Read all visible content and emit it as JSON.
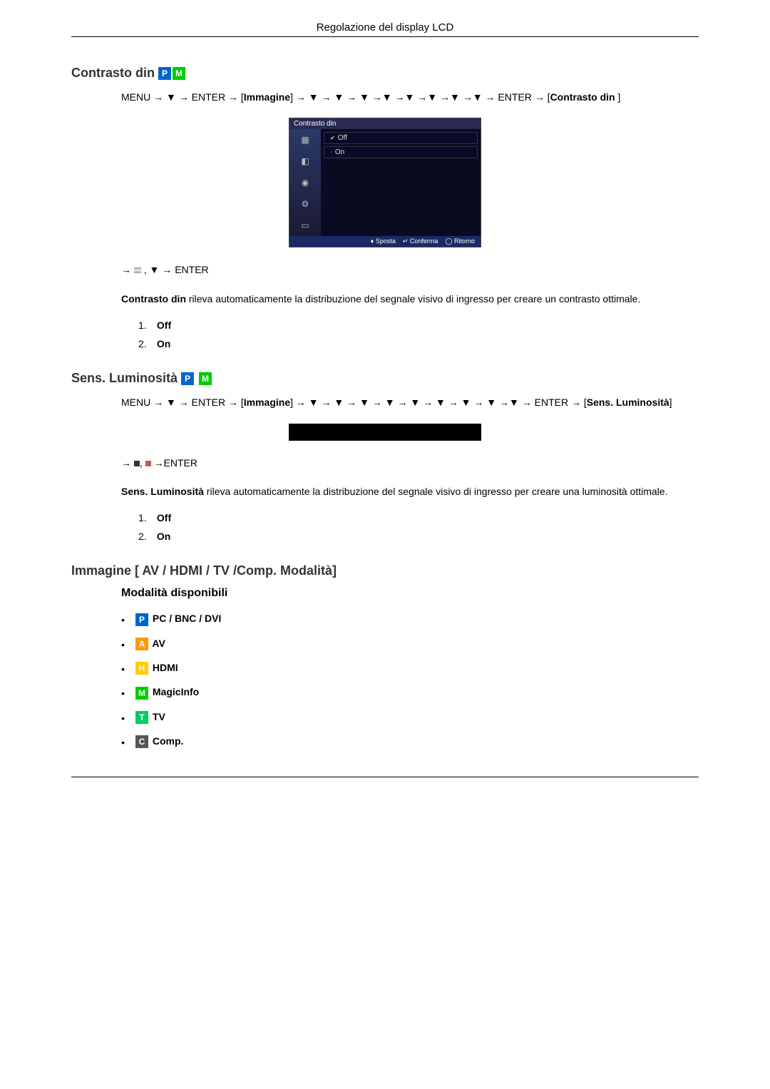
{
  "header": {
    "title": "Regolazione del display LCD"
  },
  "section1": {
    "title": "Contrasto din",
    "path": "MENU → ▼ → ENTER → [Immagine] → ▼ → ▼ → ▼ →▼ →▼ →▼ →▼ →▼ → ENTER → [Contrasto din ]",
    "path_part1": "MENU → ▼ → ENTER → [",
    "path_immagine": "Immagine",
    "path_part2": "] → ▼ → ▼ → ▼ →▼ →▼ →▼ →▼ →▼ → ENTER → [",
    "path_bold": "Contrasto din ",
    "path_part3": "]",
    "osd": {
      "title": "Contrasto din",
      "opt_off": "Off",
      "opt_on": "On",
      "foot_move": "Sposta",
      "foot_confirm": "Conferma",
      "foot_return": "Ritorno"
    },
    "nav_line_prefix": "→ ",
    "nav_line_suffix": " , ▼ → ENTER",
    "desc_prefix": "Contrasto din",
    "desc_rest": " rileva automaticamente la distribuzione del segnale visivo di ingresso per creare un contrasto ottimale.",
    "opt1_num": "1.",
    "opt1_label": "Off",
    "opt2_num": "2.",
    "opt2_label": "On"
  },
  "section2": {
    "title": "Sens. Luminosità ",
    "path_part1": "MENU → ▼ → ENTER → [",
    "path_immagine": "Immagine",
    "path_part2": "] → ▼ → ▼ → ▼ → ▼ → ▼ → ▼ → ▼ → ▼ →▼ → ENTER → [",
    "path_bold": "Sens. Luminosità",
    "path_part3": "]",
    "osd": {
      "label_left": "",
      "label_right": ""
    },
    "nav_line_prefix": "→ ",
    "nav_line_mid": ", ",
    "nav_line_suffix": " →ENTER",
    "desc_prefix": "Sens. Luminosità",
    "desc_rest": " rileva automaticamente la distribuzione del segnale visivo di ingresso per creare una luminosità ottimale.",
    "opt1_num": "1.",
    "opt1_label": "Off",
    "opt2_num": "2.",
    "opt2_label": "On"
  },
  "section3": {
    "title": "Immagine [ AV / HDMI / TV /Comp. Modalità]",
    "sub_heading": "Modalità disponibili",
    "modes": {
      "p": {
        "letter": "P",
        "label": " PC / BNC / DVI"
      },
      "a": {
        "letter": "A",
        "label": " AV"
      },
      "h": {
        "letter": "H",
        "label": " HDMI"
      },
      "m": {
        "letter": "M",
        "label": " MagicInfo"
      },
      "t": {
        "letter": "T",
        "label": " TV"
      },
      "c": {
        "letter": "C",
        "label": " Comp."
      }
    }
  },
  "badges": {
    "p": "P",
    "m": "M"
  }
}
